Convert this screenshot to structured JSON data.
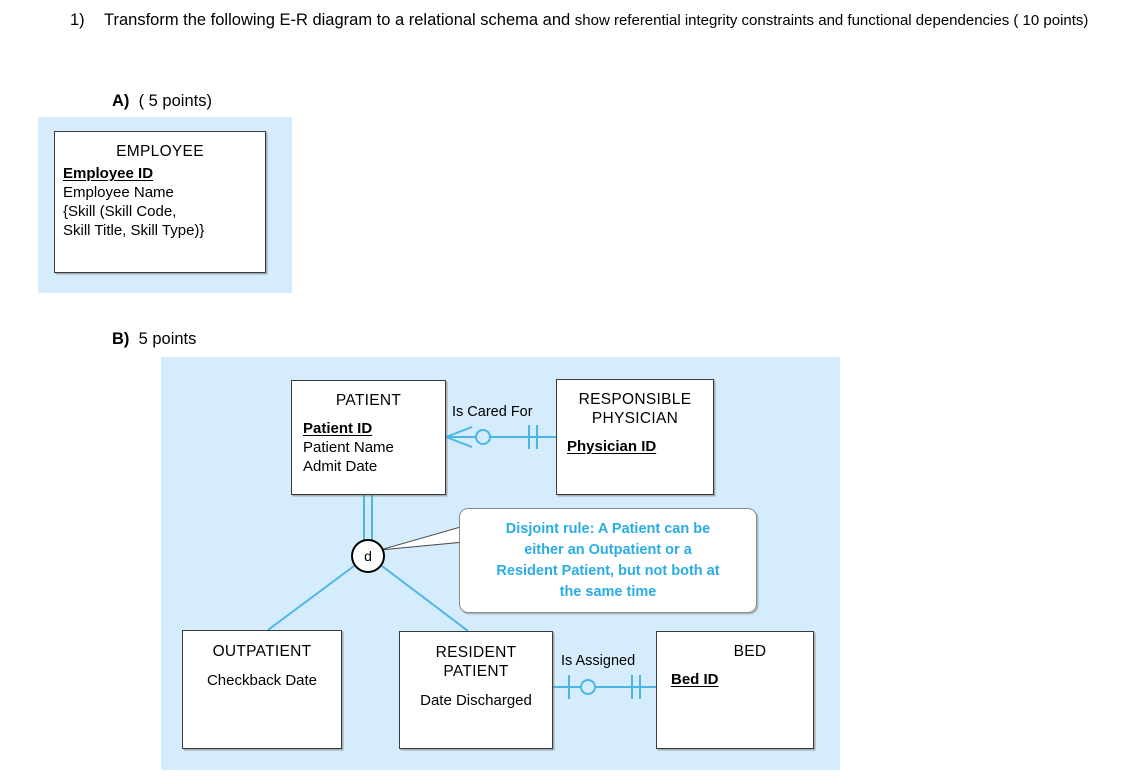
{
  "question": {
    "number": "1)",
    "text_main": "Transform the following E-R diagram  to a relational schema  and ",
    "text_tail": "show referential integrity constraints and functional dependencies ( 10 points)"
  },
  "sections": [
    {
      "letter": "A)",
      "points": "( 5 points)"
    },
    {
      "letter": "B)",
      "points": "5 points"
    }
  ],
  "colors": {
    "panel_blue": "#d4ecfb",
    "line_blue": "#4ab6e8",
    "callout_text": "#29ade4",
    "entity_border": "#3a3a3a",
    "attr_shade": "#e2e2e2"
  },
  "part_a": {
    "entity": {
      "title": "EMPLOYEE",
      "attributes": [
        {
          "label": "Employee ID",
          "key": true,
          "shaded": false
        },
        {
          "label": "Employee Name",
          "key": false,
          "shaded": false
        },
        {
          "label": "{Skill (Skill Code,",
          "key": false,
          "shaded": true
        },
        {
          "label": "Skill Title, Skill Type)}",
          "key": false,
          "shaded": true
        }
      ]
    }
  },
  "part_b": {
    "entities": {
      "patient": {
        "title": "PATIENT",
        "attributes": [
          {
            "label": "Patient ID",
            "key": true
          },
          {
            "label": "Patient Name",
            "key": false
          },
          {
            "label": "Admit Date",
            "key": false
          }
        ]
      },
      "physician": {
        "title_line1": "RESPONSIBLE",
        "title_line2": "PHYSICIAN",
        "attributes": [
          {
            "label": "Physician ID",
            "key": true
          }
        ]
      },
      "outpatient": {
        "title": "OUTPATIENT",
        "attributes": [
          {
            "label": "Checkback Date",
            "key": false
          }
        ]
      },
      "resident": {
        "title_line1": "RESIDENT",
        "title_line2": "PATIENT",
        "attributes": [
          {
            "label": "Date Discharged",
            "key": false
          }
        ]
      },
      "bed": {
        "title": "BED",
        "attributes": [
          {
            "label": "Bed ID",
            "key": true
          }
        ]
      }
    },
    "relationships": [
      {
        "name": "is-cared-for",
        "label": "Is Cared For"
      },
      {
        "name": "is-assigned",
        "label": "Is Assigned"
      }
    ],
    "disjoint_symbol": "d",
    "callout": {
      "line1": "Disjoint rule: A Patient can be",
      "line2": "either an Outpatient or a",
      "line3": "Resident Patient, but not both at",
      "line4": "the same time"
    }
  }
}
